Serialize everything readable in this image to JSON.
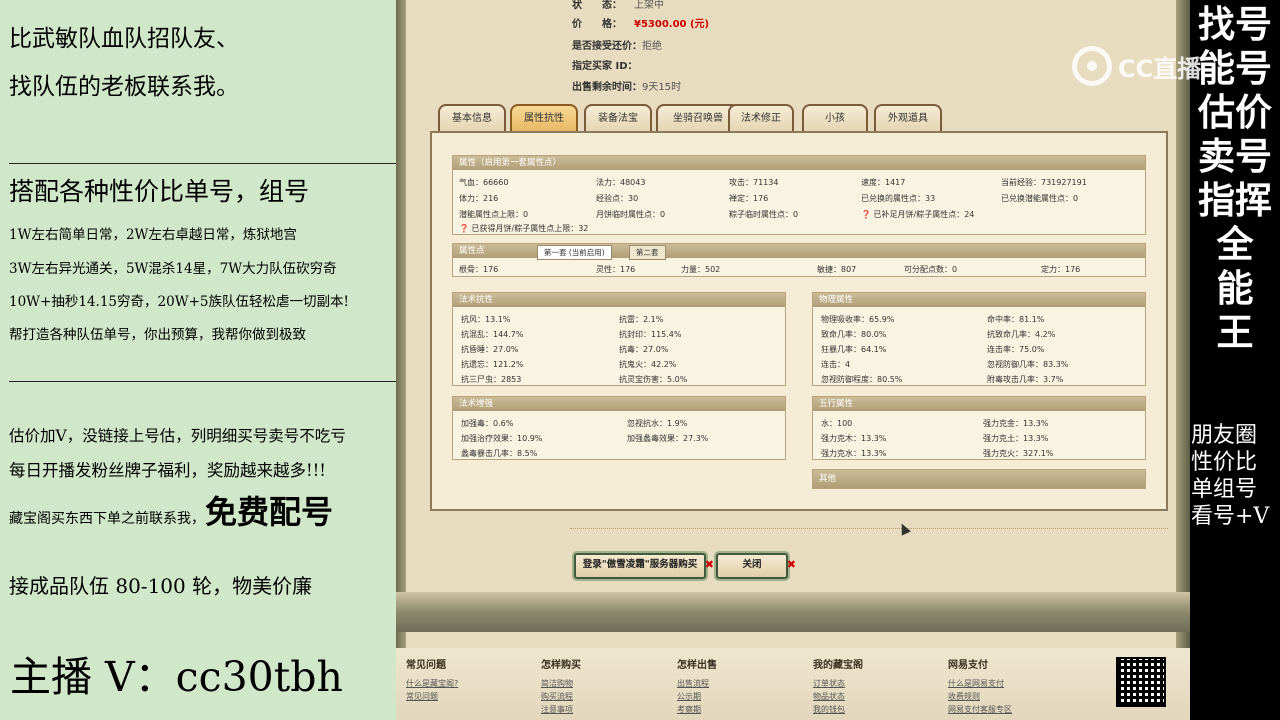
{
  "left_panel": {
    "recruit_line1": "比武敏队血队招队友、",
    "recruit_line2": "找队伍的老板联系我。",
    "combo_title": "搭配各种性价比单号，组号",
    "combo_lines": [
      "1W左右简单日常，2W左右卓越日常，炼狱地宫",
      "3W左右异光通关，5W混杀14星，7W大力队伍砍穷奇",
      "10W+抽秒14.15穷奇，20W+5族队伍轻松虐一切副本!",
      "帮打造各种队伍单号，你出预算，我帮你做到极致"
    ],
    "appraise_line1": "估价加V，没链接上号估，列明细买号卖号不吃亏",
    "appraise_line2": "每日开播发粉丝牌子福利，奖励越来越多!!!",
    "treasure_prefix": "藏宝阁买东西下单之前联系我，",
    "treasure_highlight": "免费配号",
    "team_line": "接成品队伍 80-100 轮，物美价廉",
    "host_line": "主播 V：cc30tbh"
  },
  "right_panel": {
    "top_banner": [
      "找号",
      "能号",
      "估价",
      "卖号",
      "指挥",
      "全",
      "能",
      "王"
    ],
    "bottom_lines": [
      "朋友圈",
      "性价比",
      "单组号",
      "看号+V"
    ],
    "logo_text": "CC直播"
  },
  "listing": {
    "status_label": "状　　态：",
    "status_value": "上架中",
    "price_label": "价　　格：",
    "price_value": "¥5300.00 (元)",
    "bargain_label": "是否接受还价：",
    "bargain_value": "拒绝",
    "buyer_label": "指定买家 ID：",
    "buyer_value": "",
    "remaining_label": "出售剩余时间：",
    "remaining_value": "9天15时"
  },
  "tabs": [
    "基本信息",
    "属性抗性",
    "装备法宝",
    "坐骑召唤兽",
    "法术修正",
    "小孩",
    "外观道具"
  ],
  "attributes": {
    "header": "属性（启用第一套属性点）",
    "rows": [
      [
        "气血：66660",
        "法力：48043",
        "攻击：71134",
        "速度：1417",
        "当前经验：731927191"
      ],
      [
        "体力：216",
        "经验点：30",
        "禅定：176",
        "已兑换的属性点：33",
        "已兑换潜能属性点：0"
      ],
      [
        "潜能属性点上限：0",
        "月饼临时属性点：0",
        "粽子临时属性点：0",
        "❓ 已补足月饼/粽子属性点：24",
        ""
      ],
      [
        "❓ 已获得月饼/粽子属性点上限：32",
        "",
        "",
        "",
        ""
      ]
    ]
  },
  "attribute_points": {
    "header": "属性点",
    "subtabs": [
      "第一套 (当前启用)",
      "第二套"
    ],
    "row": [
      "根骨：176",
      "灵性：176",
      "力量：502",
      "敏捷：807",
      "可分配点数：0",
      "定力：176"
    ]
  },
  "resistance": {
    "header": "法术抗性",
    "rows": [
      [
        "抗风：13.1%",
        "抗雷：2.1%"
      ],
      [
        "抗混乱：144.7%",
        "抗封印：115.4%"
      ],
      [
        "抗昏睡：27.0%",
        "抗毒：27.0%"
      ],
      [
        "抗遗忘：121.2%",
        "抗鬼火：42.2%"
      ],
      [
        "抗三尸虫：2853",
        "抗灵宝伤害：5.0%"
      ]
    ]
  },
  "physical": {
    "header": "物理属性",
    "rows": [
      [
        "物理吸收率：65.9%",
        "命中率：81.1%"
      ],
      [
        "致命几率：80.0%",
        "抗致命几率：4.2%"
      ],
      [
        "狂暴几率：64.1%",
        "连击率：75.0%"
      ],
      [
        "连击：4",
        "忽视防御几率：83.3%"
      ],
      [
        "忽视防御程度：80.5%",
        "附毒攻击几率：3.7%"
      ]
    ]
  },
  "spell_boost": {
    "header": "法术增强",
    "rows": [
      [
        "加强毒：0.6%",
        "忽视抗水：1.9%"
      ],
      [
        "加强治疗效果：10.9%",
        "加强蠡毒效果：27.3%"
      ],
      [
        "蠡毒暴击几率：8.5%",
        ""
      ]
    ]
  },
  "five_elements": {
    "header": "五行属性",
    "rows": [
      [
        "水：100",
        "强力克金：13.3%"
      ],
      [
        "强力克木：13.3%",
        "强力克土：13.3%"
      ],
      [
        "强力克水：13.3%",
        "强力克火：327.1%"
      ]
    ]
  },
  "other": {
    "header": "其他"
  },
  "buttons": {
    "login_buy": "登录\"傲雪凌霜\"服务器购买",
    "close": "关闭"
  },
  "footer": {
    "columns": [
      {
        "title": "常见问题",
        "links": [
          "什么是藏宝阁?",
          "常见问题"
        ]
      },
      {
        "title": "怎样购买",
        "links": [
          "简洁购物",
          "购买流程",
          "注意事项"
        ]
      },
      {
        "title": "怎样出售",
        "links": [
          "出售流程",
          "公示期",
          "考察期"
        ]
      },
      {
        "title": "我的藏宝阁",
        "links": [
          "订单状态",
          "物品状态",
          "我的钱包"
        ]
      },
      {
        "title": "网易支付",
        "links": [
          "什么是网易支付",
          "收费规则",
          "网易支付客服专区"
        ]
      }
    ]
  }
}
